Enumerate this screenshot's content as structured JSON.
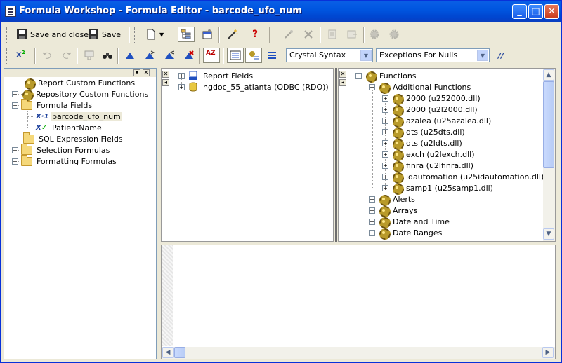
{
  "window": {
    "title": "Formula Workshop - Formula Editor - barcode_ufo_num"
  },
  "title_buttons": {
    "minimize": "_",
    "maximize": "□",
    "close": "✕"
  },
  "toolbar1": {
    "save_close_label": "Save and close",
    "save_label": "Save"
  },
  "toolbar2": {
    "syntax_value": "Crystal Syntax",
    "nulls_value": "Exceptions For Nulls",
    "comment_glyph": "//"
  },
  "workshop_tree": {
    "items": [
      {
        "label": "Report Custom Functions",
        "expander": ""
      },
      {
        "label": "Repository Custom Functions",
        "expander": "+"
      },
      {
        "label": "Formula Fields",
        "expander": "−"
      },
      {
        "label": "barcode_ufo_num",
        "expander": ""
      },
      {
        "label": "PatientName",
        "expander": ""
      },
      {
        "label": "SQL Expression Fields",
        "expander": ""
      },
      {
        "label": "Selection Formulas",
        "expander": "+"
      },
      {
        "label": "Formatting Formulas",
        "expander": "+"
      }
    ]
  },
  "fields_tree": {
    "items": [
      {
        "label": "Report Fields",
        "expander": "+"
      },
      {
        "label": "ngdoc_55_atlanta (ODBC (RDO))",
        "expander": "+"
      }
    ]
  },
  "functions_tree": {
    "root": "Functions",
    "additional": "Additional Functions",
    "dlls": [
      "2000 (u252000.dll)",
      "2000 (u2l2000.dll)",
      "azalea (u25azalea.dll)",
      "dts (u25dts.dll)",
      "dts (u2ldts.dll)",
      "exch (u2lexch.dll)",
      "finra (u2lfinra.dll)",
      "idautomation (u25idautomation.dll)",
      "samp1 (u25samp1.dll)"
    ],
    "groups": [
      "Alerts",
      "Arrays",
      "Date and Time",
      "Date Ranges"
    ]
  },
  "colors": {
    "accent": "#0A5FE6",
    "selection": "#ECE9D8",
    "border": "#7F9DB9"
  }
}
